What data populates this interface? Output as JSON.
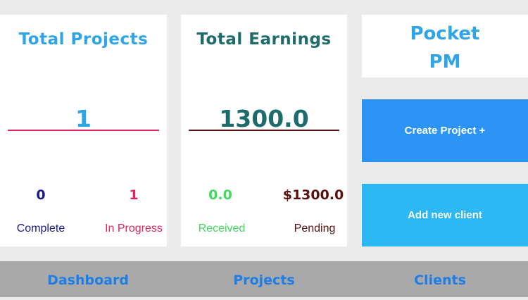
{
  "projects_card": {
    "title": "Total Projects",
    "total": "1",
    "complete_count": "0",
    "complete_label": "Complete",
    "in_progress_count": "1",
    "in_progress_label": "In Progress"
  },
  "earnings_card": {
    "title": "Total Earnings",
    "total": "1300.0",
    "received_amount": "0.0",
    "received_label": "Received",
    "pending_amount": "$1300.0",
    "pending_label": "Pending"
  },
  "brand": {
    "line1": "Pocket",
    "line2": "PM"
  },
  "actions": {
    "create_project": "Create Project +",
    "add_client": "Add new client"
  },
  "tabs": [
    {
      "label": "Dashboard"
    },
    {
      "label": "Projects"
    },
    {
      "label": "Clients"
    }
  ],
  "colors": {
    "page_background": "#ebebeb",
    "card_background": "#ffffff",
    "projects_title": "#2fa4e7",
    "projects_total": "#2fa4e7",
    "projects_divider": "#e0245e",
    "complete": "#1a1a8c",
    "in_progress": "#e0245e",
    "earnings_title": "#1d6b6b",
    "earnings_total": "#1d6b6b",
    "earnings_divider": "#5c1010",
    "received": "#3ddc5c",
    "pending": "#5c1010",
    "brand_text": "#2fa4e7",
    "create_button": "#2b94f5",
    "add_client_button": "#2bb8f5",
    "tabbar_background": "#a9a9a9",
    "tab_text": "#1e7ee8"
  }
}
